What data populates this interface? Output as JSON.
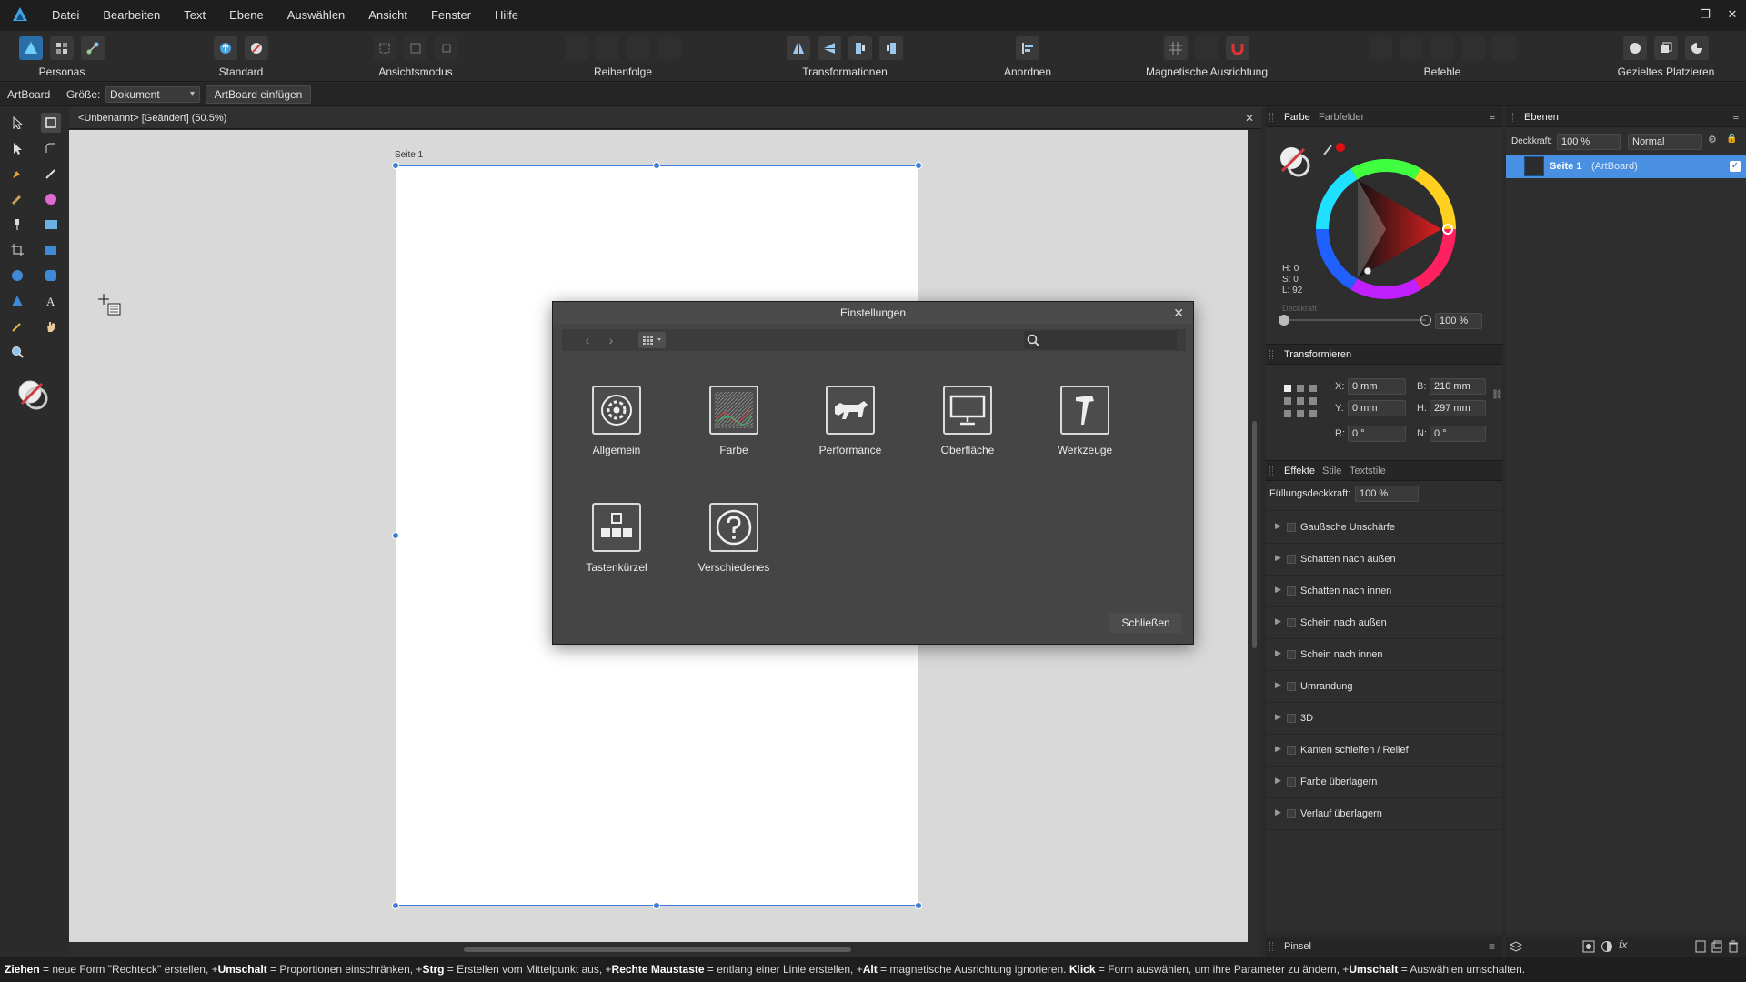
{
  "menubar": {
    "items": [
      "Datei",
      "Bearbeiten",
      "Text",
      "Ebene",
      "Auswählen",
      "Ansicht",
      "Fenster",
      "Hilfe"
    ],
    "window_controls": [
      "–",
      "❐",
      "✕"
    ]
  },
  "toolbar": {
    "groups": [
      {
        "label": "Personas",
        "icons": [
          "designer-persona-icon",
          "pixel-persona-icon",
          "export-persona-icon"
        ]
      },
      {
        "label": "Standard",
        "icons": [
          "share-icon",
          "assistant-icon"
        ]
      },
      {
        "label": "Ansichtsmodus",
        "icons": [
          "view-mode-icon",
          "view-mode-icon",
          "view-mode-icon"
        ]
      },
      {
        "label": "Reihenfolge",
        "icons": [
          "order-icon",
          "order-icon",
          "order-icon",
          "order-icon"
        ]
      },
      {
        "label": "Transformationen",
        "icons": [
          "flip-horizontal-icon",
          "flip-vertical-icon",
          "rotate-left-icon",
          "rotate-right-icon"
        ]
      },
      {
        "label": "Anordnen",
        "icons": [
          "align-icon"
        ]
      },
      {
        "label": "Magnetische Ausrichtung",
        "icons": [
          "snapping-grid-icon",
          "snapping-icon",
          "magnet-icon"
        ]
      },
      {
        "label": "Befehle",
        "icons": [
          "boolean-icon",
          "boolean-icon",
          "boolean-icon",
          "boolean-icon",
          "boolean-icon"
        ]
      },
      {
        "label": "Gezieltes Platzieren",
        "icons": [
          "insert-icon",
          "insert-icon",
          "insert-icon"
        ]
      }
    ]
  },
  "contextbar": {
    "tool_name": "ArtBoard",
    "size_label": "Größe:",
    "size_value": "Dokument",
    "insert_button": "ArtBoard einfügen"
  },
  "document": {
    "tab_title": "<Unbenannt> [Geändert] (50.5%)",
    "close": "✕",
    "artboard_label": "Seite 1"
  },
  "dialog": {
    "title": "Einstellungen",
    "close_x": "✕",
    "search_placeholder": "",
    "items": [
      {
        "label": "Allgemein",
        "icon": "gear-icon"
      },
      {
        "label": "Farbe",
        "icon": "color-swatch-icon"
      },
      {
        "label": "Performance",
        "icon": "cheetah-icon"
      },
      {
        "label": "Oberfläche",
        "icon": "monitor-icon"
      },
      {
        "label": "Werkzeuge",
        "icon": "hammer-icon"
      },
      {
        "label": "Tastenkürzel",
        "icon": "keyboard-icon"
      },
      {
        "label": "Verschiedenes",
        "icon": "question-icon"
      }
    ],
    "close_button": "Schließen"
  },
  "color_panel": {
    "tabs": [
      "Farbe",
      "Farbfelder"
    ],
    "hsl": [
      "H: 0",
      "S: 0",
      "L: 92"
    ],
    "opacity_label": "Deckkraft",
    "opacity_value": "100 %"
  },
  "transform_panel": {
    "title": "Transformieren",
    "x_label": "X:",
    "x_value": "0 mm",
    "y_label": "Y:",
    "y_value": "0 mm",
    "w_label": "B:",
    "w_value": "210 mm",
    "h_label": "H:",
    "h_value": "297 mm",
    "r_label": "R:",
    "r_value": "0 °",
    "s_label": "N:",
    "s_value": "0 °"
  },
  "effects_panel": {
    "tabs": [
      "Effekte",
      "Stile",
      "Textstile"
    ],
    "fill_opacity_label": "Füllungsdeckkraft:",
    "fill_opacity_value": "100 %",
    "effects": [
      "Gaußsche Unschärfe",
      "Schatten nach außen",
      "Schatten nach innen",
      "Schein nach außen",
      "Schein nach innen",
      "Umrandung",
      "3D",
      "Kanten schleifen / Relief",
      "Farbe überlagern",
      "Verlauf überlagern"
    ]
  },
  "brush_panel": {
    "title": "Pinsel"
  },
  "layers_panel": {
    "tab": "Ebenen",
    "opacity_label": "Deckkraft:",
    "opacity_value": "100 %",
    "blend_mode": "Normal",
    "layer_name": "Seite 1",
    "layer_type": "(ArtBoard)"
  },
  "statusbar": {
    "segments": [
      {
        "b": "Ziehen",
        "t": " = neue Form \"Rechteck\" erstellen, +"
      },
      {
        "b": "Umschalt",
        "t": " = Proportionen einschränken, +"
      },
      {
        "b": "Strg",
        "t": " = Erstellen vom Mittelpunkt aus, +"
      },
      {
        "b": "Rechte Maustaste",
        "t": " = entlang einer Linie erstellen, +"
      },
      {
        "b": "Alt",
        "t": " = magnetische Ausrichtung ignorieren. "
      },
      {
        "b": "Klick",
        "t": " = Form auswählen, um ihre Parameter zu ändern, +"
      },
      {
        "b": "Umschalt",
        "t": " = Auswählen umschalten."
      }
    ]
  },
  "colors": {
    "accent": "#3d7fd6",
    "selection": "#4a90e2",
    "background": "#2a2a2a"
  }
}
